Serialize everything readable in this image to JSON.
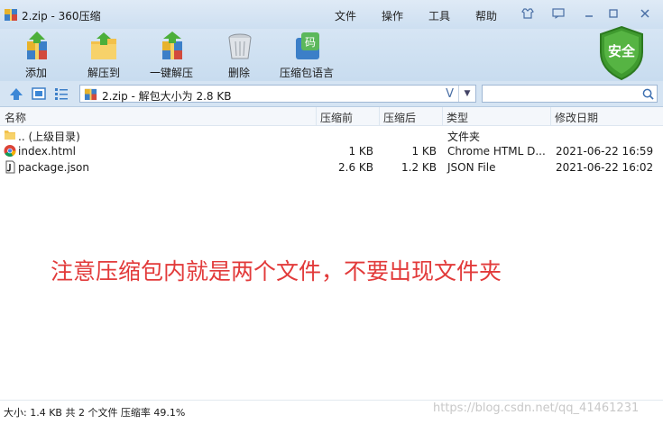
{
  "window": {
    "title": "2.zip - 360压缩",
    "menu": [
      "文件",
      "操作",
      "工具",
      "帮助"
    ]
  },
  "toolbar": {
    "items": [
      {
        "label": "添加",
        "icon": "add-archive-icon"
      },
      {
        "label": "解压到",
        "icon": "extract-to-icon"
      },
      {
        "label": "一键解压",
        "icon": "one-click-extract-icon"
      },
      {
        "label": "删除",
        "icon": "delete-icon"
      },
      {
        "label": "压缩包语言",
        "icon": "archive-language-icon"
      }
    ],
    "security_badge": "安全"
  },
  "address": {
    "path": "2.zip - 解包大小为 2.8 KB",
    "dropdown_glyph": "V",
    "search_placeholder": ""
  },
  "columns": [
    "名称",
    "压缩前",
    "压缩后",
    "类型",
    "修改日期"
  ],
  "files": [
    {
      "name": ".. (上级目录)",
      "size_before": "",
      "size_after": "",
      "type": "文件夹",
      "modified": "",
      "icon": "folder-icon"
    },
    {
      "name": "index.html",
      "size_before": "1 KB",
      "size_after": "1 KB",
      "type": "Chrome HTML D...",
      "modified": "2021-06-22 16:59",
      "icon": "chrome-html-icon"
    },
    {
      "name": "package.json",
      "size_before": "2.6 KB",
      "size_after": "1.2 KB",
      "type": "JSON File",
      "modified": "2021-06-22 16:02",
      "icon": "json-file-icon"
    }
  ],
  "annotation": "注意压缩包内就是两个文件，不要出现文件夹",
  "status": "大小: 1.4 KB 共 2 个文件 压缩率 49.1%",
  "watermark": "https://blog.csdn.net/qq_41461231",
  "colors": {
    "annotation": "#e23a3a",
    "toolbar_bg": "#c8dcef",
    "security_green": "#3f9a2f"
  }
}
